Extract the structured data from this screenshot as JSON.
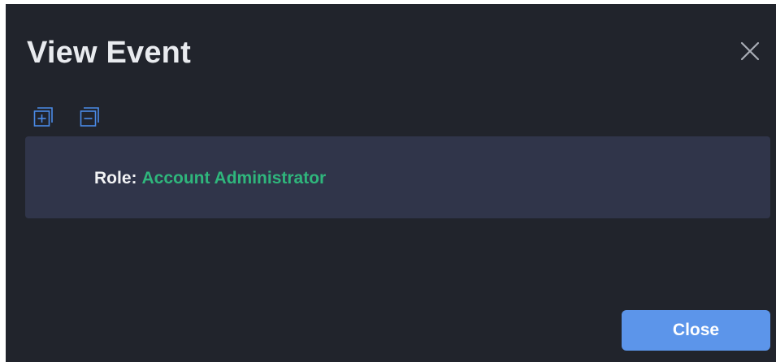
{
  "dialog": {
    "title": "View Event",
    "close_icon": "close-icon",
    "toolbar": {
      "expand_icon": "expand-all-icon",
      "collapse_icon": "collapse-all-icon"
    },
    "fields": [
      {
        "label": "Role:",
        "value": "Account Administrator"
      }
    ],
    "footer": {
      "close_label": "Close"
    }
  },
  "colors": {
    "background": "#21242c",
    "panel": "#30354a",
    "accent_value": "#2fb67c",
    "icon_blue": "#4a8be8",
    "primary_button": "#5c95ea",
    "title_text": "#e9ebef"
  }
}
